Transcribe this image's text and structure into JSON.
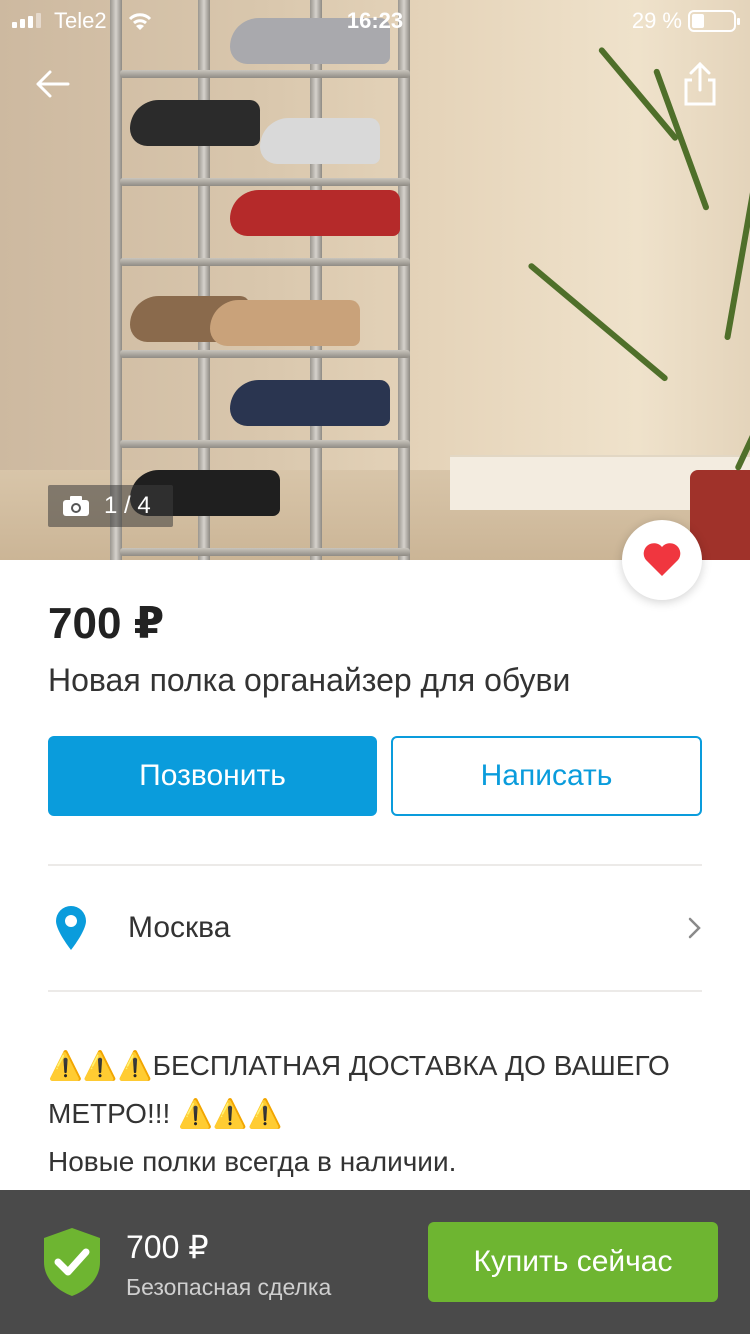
{
  "status_bar": {
    "carrier": "Tele2",
    "time": "16:23",
    "battery_text": "29 %",
    "battery_level": 0.29
  },
  "photo": {
    "counter": "1 / 4",
    "icons": [
      "back-arrow-icon",
      "share-icon",
      "camera-icon",
      "heart-icon"
    ]
  },
  "listing": {
    "price": "700 ₽",
    "title": "Новая полка органайзер для обуви"
  },
  "actions": {
    "call_label": "Позвонить",
    "write_label": "Написать"
  },
  "location": {
    "city": "Москва"
  },
  "description": {
    "line1": "⚠️⚠️⚠️БЕСПЛАТНАЯ ДОСТАВКА ДО ВАШЕГО МЕТРО!!! ⚠️⚠️⚠️",
    "line2": "Новые полки всегда в наличии."
  },
  "bottom_bar": {
    "price": "700 ₽",
    "safe_deal": "Безопасная сделка",
    "buy_label": "Купить сейчас"
  },
  "colors": {
    "accent_blue": "#0a9cdc",
    "buy_green": "#6eb531",
    "heart_red": "#f0363f",
    "bottom_bar_bg": "#4a4a4a"
  }
}
